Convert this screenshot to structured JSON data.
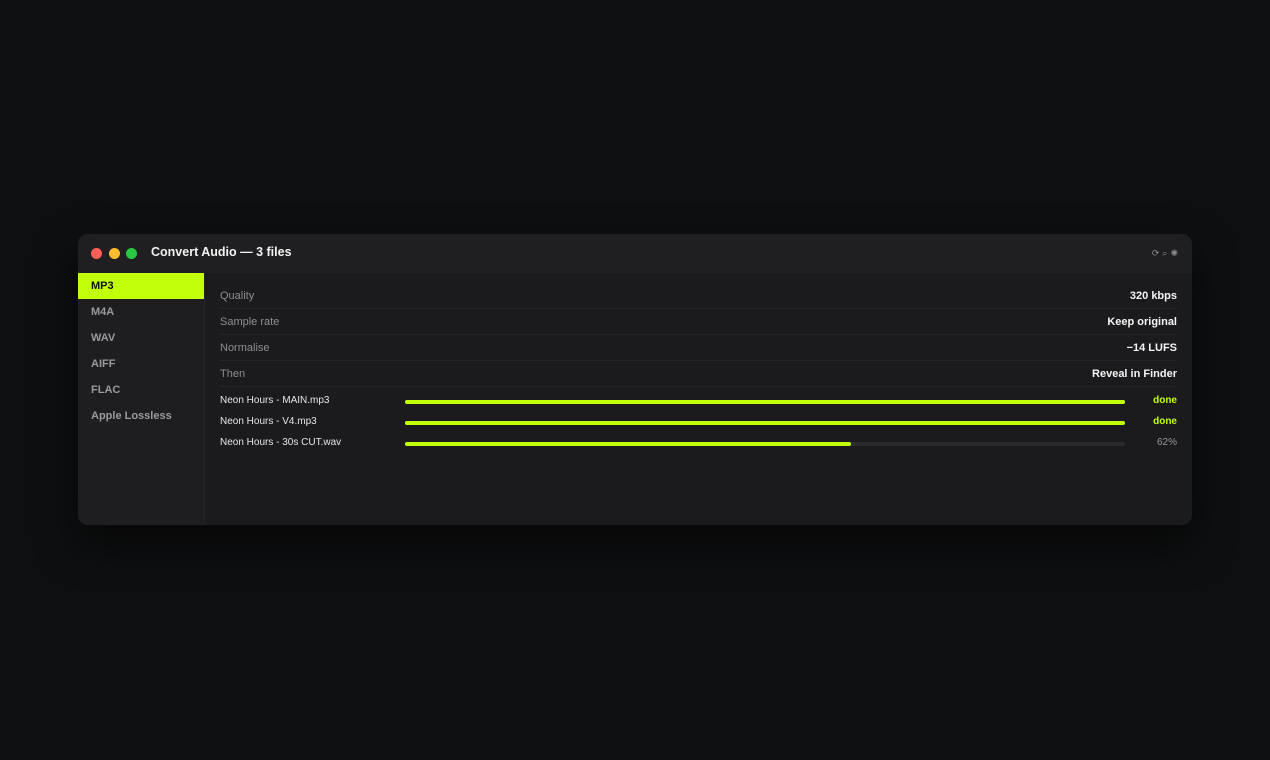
{
  "window": {
    "title": "Convert Audio — 3 files"
  },
  "toolbar": {
    "icons": [
      "refresh-icon",
      "search-icon",
      "settings-icon"
    ],
    "refresh_glyph": "⟳",
    "search_glyph": "⌕",
    "settings_glyph": "✺"
  },
  "sidebar": {
    "items": [
      {
        "label": "MP3",
        "active": true
      },
      {
        "label": "M4A",
        "active": false
      },
      {
        "label": "WAV",
        "active": false
      },
      {
        "label": "AIFF",
        "active": false
      },
      {
        "label": "FLAC",
        "active": false
      },
      {
        "label": "Apple Lossless",
        "active": false
      }
    ]
  },
  "settings": [
    {
      "label": "Quality",
      "value": "320 kbps"
    },
    {
      "label": "Sample rate",
      "value": "Keep original"
    },
    {
      "label": "Normalise",
      "value": "−14 LUFS"
    },
    {
      "label": "Then",
      "value": "Reveal in Finder"
    }
  ],
  "files": [
    {
      "name": "Neon Hours - MAIN.mp3",
      "progress": 1.0,
      "status": "done"
    },
    {
      "name": "Neon Hours - V4.mp3",
      "progress": 1.0,
      "status": "done"
    },
    {
      "name": "Neon Hours - 30s CUT.wav",
      "progress": 0.62,
      "status": "62%"
    }
  ],
  "colors": {
    "accent": "#c2ff0a",
    "window_bg": "#1b1b1d",
    "page_bg": "#0e0f10"
  }
}
